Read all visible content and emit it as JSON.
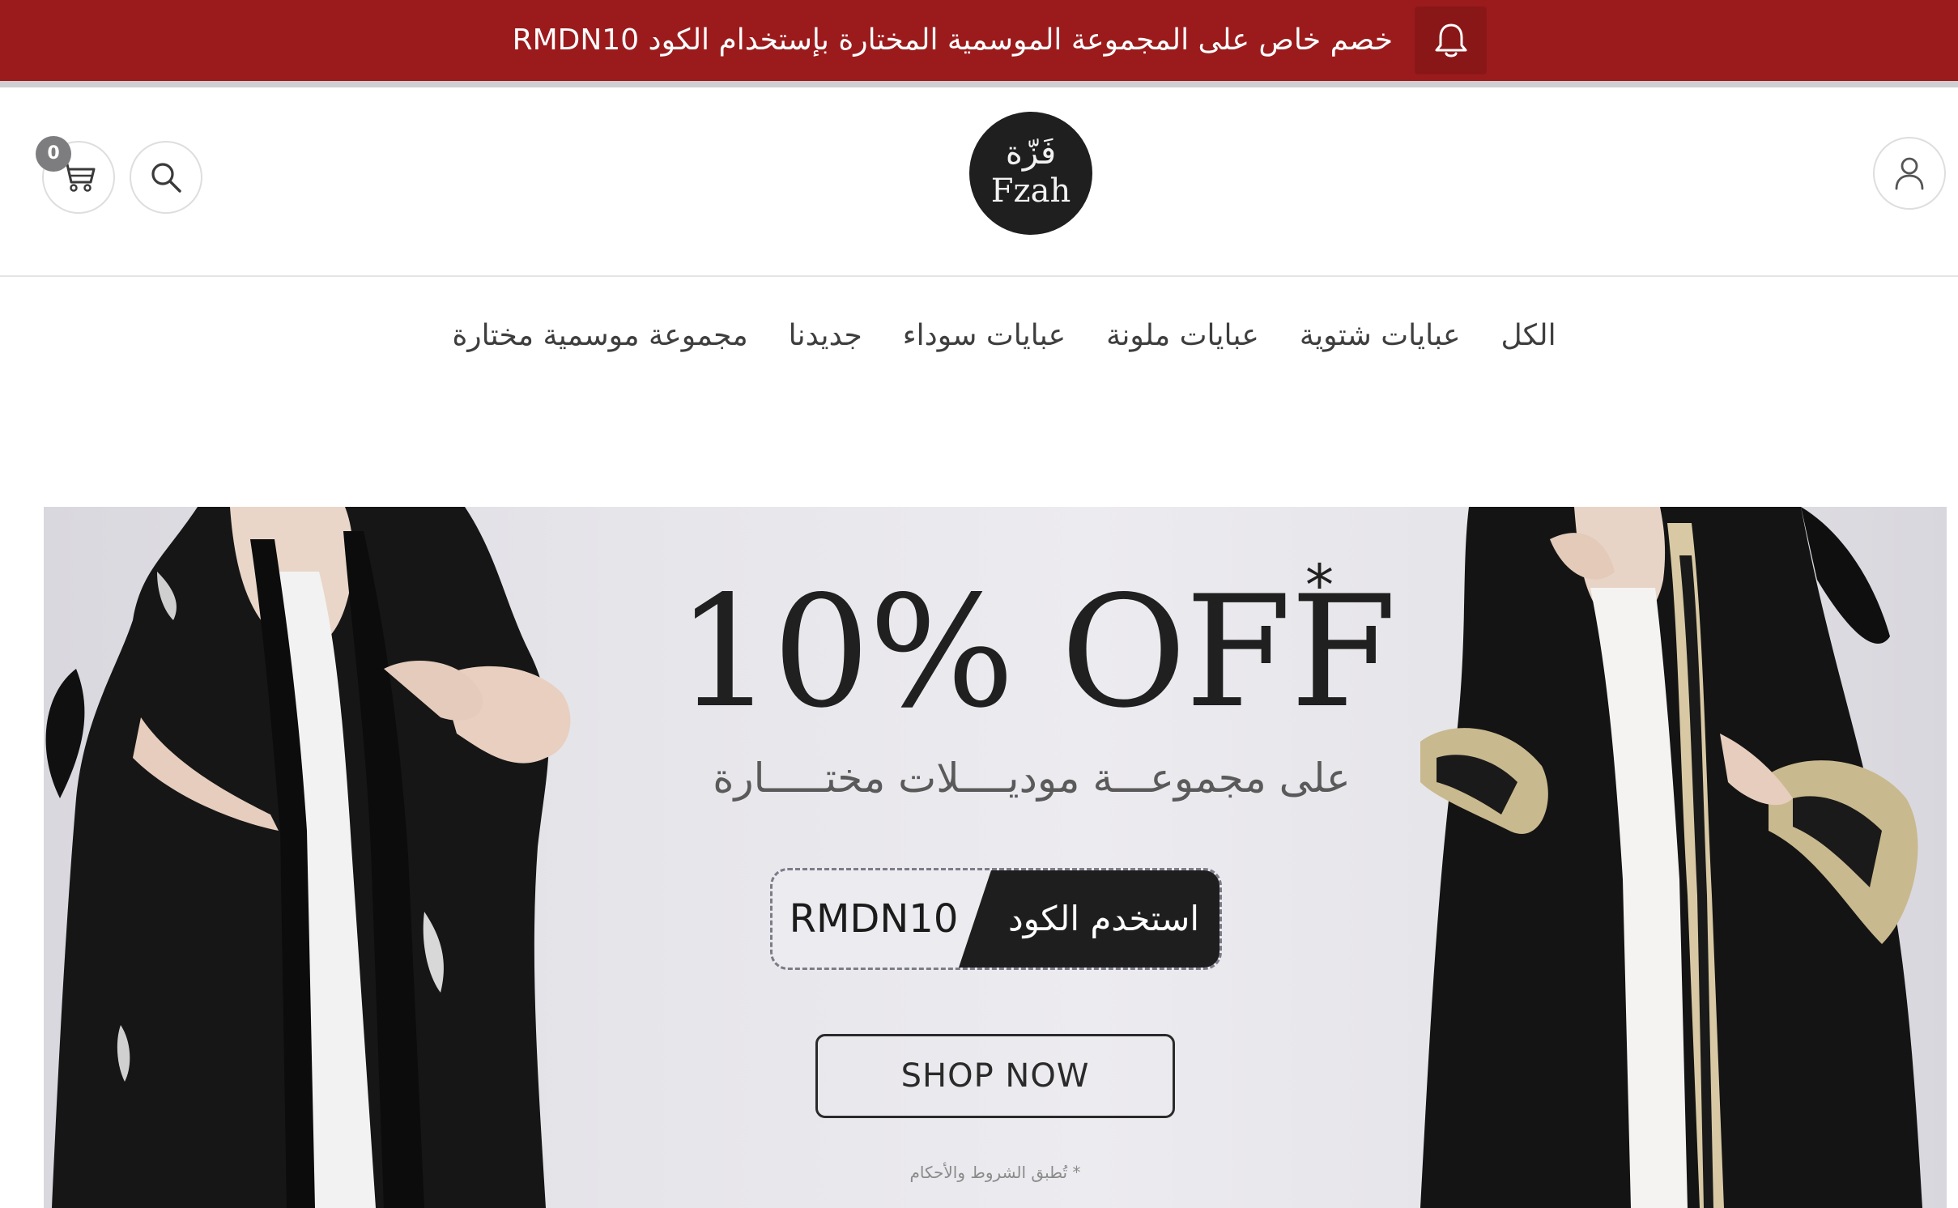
{
  "announcement": {
    "text": "خصم خاص على المجموعة الموسمية المختارة بإستخدام الكود RMDN10",
    "bell_icon": "bell-icon",
    "background_color": "#9b1b1c"
  },
  "header": {
    "cart_count": "0",
    "cart_icon": "cart-icon",
    "search_icon": "search-icon",
    "account_icon": "user-icon",
    "logo_arabic": "فَزّة",
    "logo_english": "Fzah"
  },
  "nav": {
    "items": [
      {
        "label": "مجموعة موسمية مختارة"
      },
      {
        "label": "جديدنا"
      },
      {
        "label": "عبايات سوداء"
      },
      {
        "label": "عبايات ملونة"
      },
      {
        "label": "عبايات شتوية"
      },
      {
        "label": "الكل"
      }
    ]
  },
  "hero": {
    "heading": "10% OFF",
    "heading_mark": "*",
    "subheading": "على مجموعـــة موديــــلات مختـــــارة",
    "code_label": "استخدم الكود",
    "code_value": "RMDN10",
    "cta_label": "SHOP NOW",
    "terms": "* تُطبق الشروط والأحكام"
  }
}
